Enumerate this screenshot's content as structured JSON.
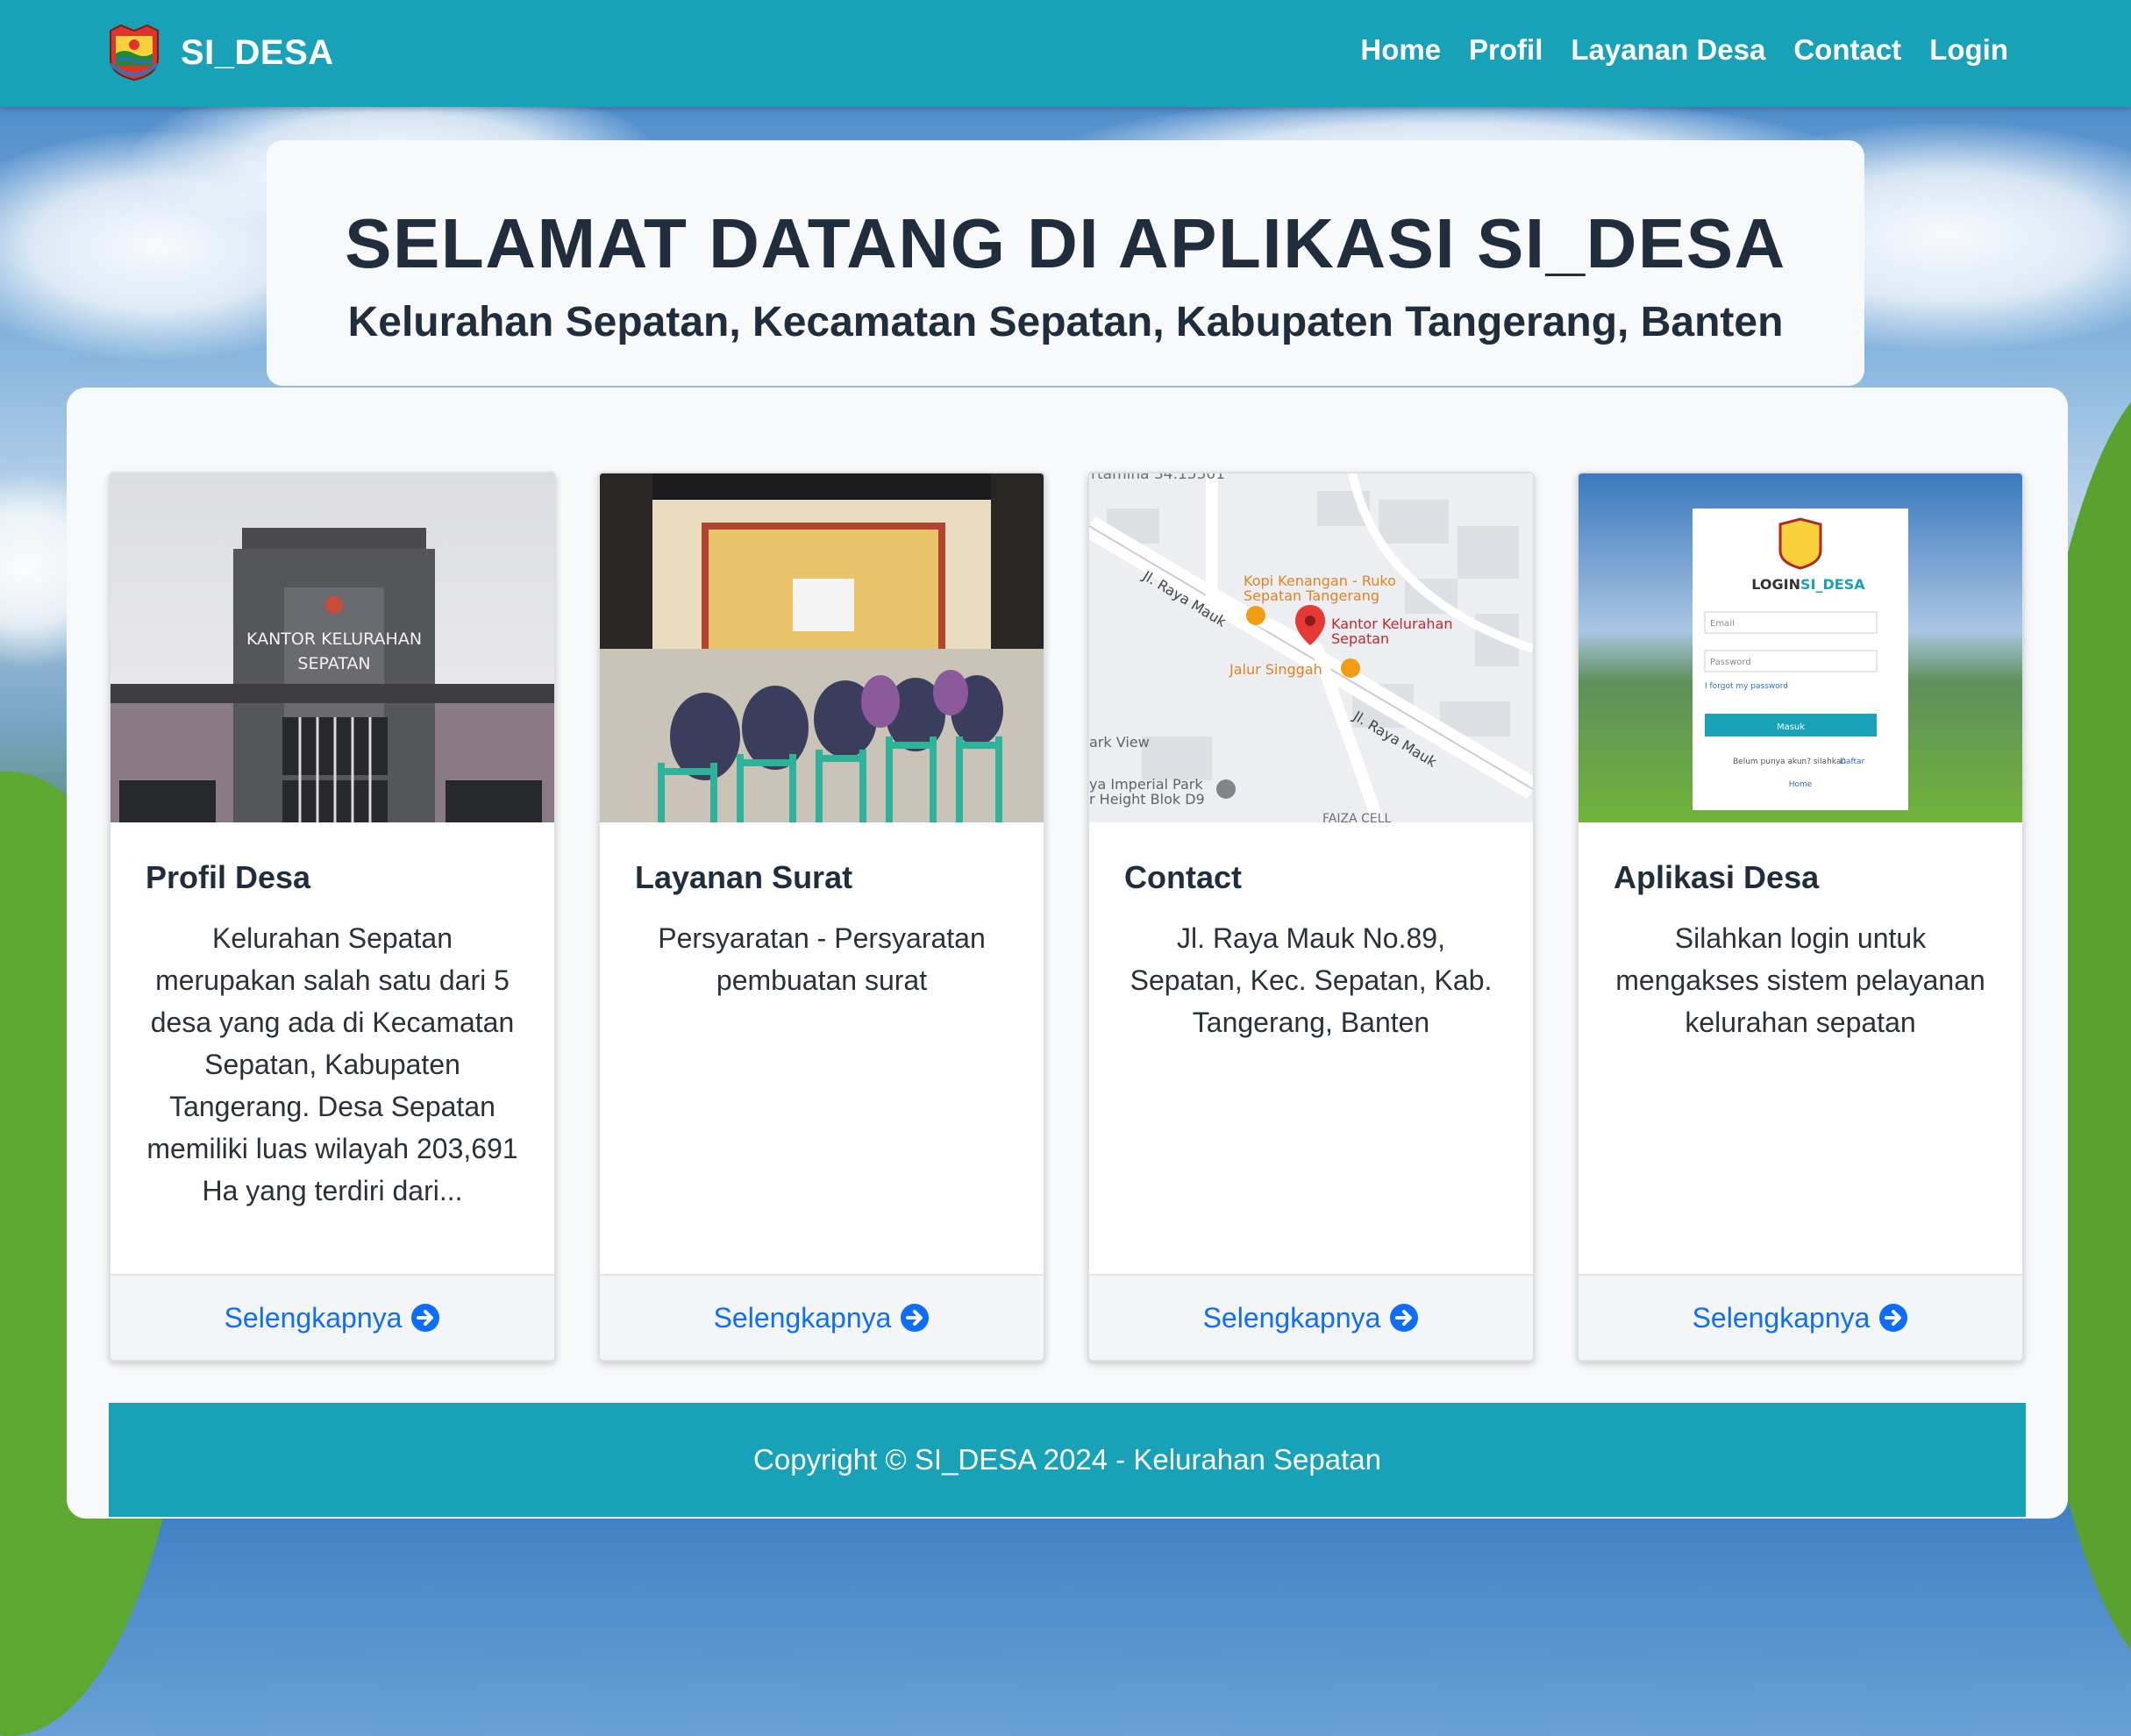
{
  "brand": {
    "name": "SI_DESA",
    "logo_icon": "village-emblem-icon"
  },
  "nav": {
    "items": [
      "Home",
      "Profil",
      "Layanan Desa",
      "Contact",
      "Login"
    ]
  },
  "hero": {
    "title": "SELAMAT DATANG DI APLIKASI SI_DESA",
    "subtitle": "Kelurahan Sepatan, Kecamatan Sepatan, Kabupaten Tangerang, Banten"
  },
  "cards": [
    {
      "title": "Profil Desa",
      "text": "Kelurahan Sepatan merupakan salah satu dari 5 desa yang ada di Kecamatan Sepatan, Kabupaten Tangerang. Desa Sepatan memiliki luas wilayah 203,691 Ha yang terdiri dari...",
      "image": "kantor-kelurahan-photo",
      "image_sign": "KANTOR KELURAHAN SEPATAN",
      "link": "Selengkapnya"
    },
    {
      "title": "Layanan Surat",
      "text": "Persyaratan - Persyaratan pembuatan surat",
      "image": "village-meeting-photo",
      "link": "Selengkapnya"
    },
    {
      "title": "Contact",
      "text": "Jl. Raya Mauk No.89, Sepatan, Kec. Sepatan, Kab. Tangerang, Banten",
      "image": "location-map",
      "map_labels": {
        "top": "rtamina 34.15501",
        "road1": "Jl. Raya Mauk",
        "road2": "Jl. Raya Mauk",
        "poi1": "Kopi Kenangan - Ruko Sepatan Tangerang",
        "poi2": "Kantor Kelurahan Sepatan",
        "poi3": "Jalur Singgah",
        "poi4": "ark View",
        "poi5": "ya Imperial Park r Height Blok D9",
        "bottom": "FAIZA CELL"
      },
      "link": "Selengkapnya"
    },
    {
      "title": "Aplikasi Desa",
      "text": "Silahkan login untuk mengakses sistem pelayanan kelurahan sepatan",
      "image": "login-screenshot",
      "login_preview": {
        "title_prefix": "LOGIN ",
        "title_brand": "SI_DESA",
        "email_placeholder": "Email",
        "password_placeholder": "Password",
        "forgot": "I forgot my password",
        "button": "Masuk",
        "register_text": "Belum punya akun? silahkan ",
        "register_link": "Daftar",
        "home": "Home"
      },
      "link": "Selengkapnya"
    }
  ],
  "footer": {
    "text": "Copyright © SI_DESA 2024 - Kelurahan Sepatan"
  },
  "colors": {
    "primary": "#17a2b8",
    "link": "#0d6efd",
    "heading": "#1f2d3d"
  }
}
